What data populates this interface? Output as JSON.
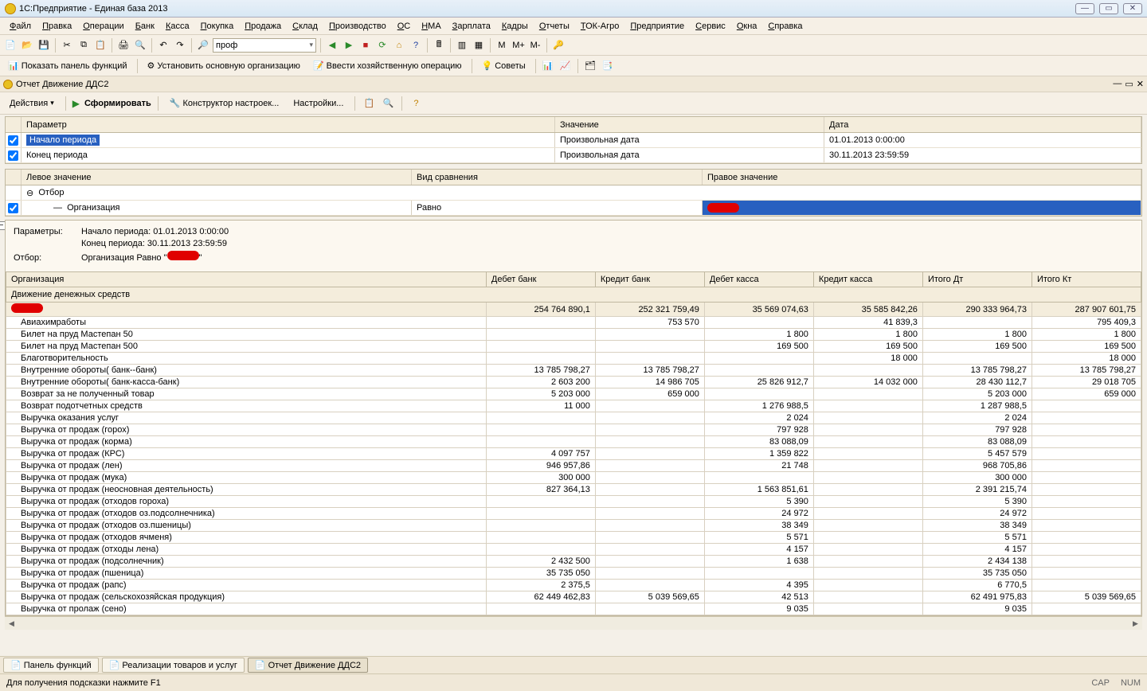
{
  "window": {
    "title": "1С:Предприятие - Единая база 2013"
  },
  "menu": [
    "Файл",
    "Правка",
    "Операции",
    "Банк",
    "Касса",
    "Покупка",
    "Продажа",
    "Склад",
    "Производство",
    "ОС",
    "НМА",
    "Зарплата",
    "Кадры",
    "Отчеты",
    "ТОК-Агро",
    "Предприятие",
    "Сервис",
    "Окна",
    "Справка"
  ],
  "toolbar": {
    "combo_value": "проф",
    "m_buttons": [
      "M",
      "M+",
      "M-"
    ]
  },
  "toolbar2": {
    "show_panel": "Показать панель функций",
    "set_org": "Установить основную организацию",
    "enter_op": "Ввести хозяйственную операцию",
    "advice": "Советы"
  },
  "doc_title": "Отчет  Движение  ДДС2",
  "reportbar": {
    "actions": "Действия",
    "generate": "Сформировать",
    "constructor": "Конструктор настроек...",
    "settings": "Настройки..."
  },
  "params_grid": {
    "headers": [
      "Параметр",
      "Значение",
      "Дата"
    ],
    "rows": [
      {
        "checked": true,
        "selected": true,
        "param": "Начало периода",
        "value": "Произвольная дата",
        "date": "01.01.2013 0:00:00"
      },
      {
        "checked": true,
        "selected": false,
        "param": "Конец периода",
        "value": "Произвольная дата",
        "date": "30.11.2013 23:59:59"
      }
    ]
  },
  "filter_grid": {
    "headers": [
      "Левое значение",
      "Вид сравнения",
      "Правое значение"
    ],
    "root": "Отбор",
    "row": {
      "checked": true,
      "left": "Организация",
      "compare": "Равно",
      "right_redacted": true
    }
  },
  "report_header": {
    "params_label": "Параметры:",
    "start": "Начало периода: 01.01.2013 0:00:00",
    "end": "Конец периода: 30.11.2013 23:59:59",
    "filter_label": "Отбор:",
    "filter_text_prefix": "Организация Равно \"",
    "filter_text_suffix": "\""
  },
  "columns": [
    "Организация",
    "Дебет банк",
    "Кредит банк",
    "Дебет касса",
    "Кредит касса",
    "Итого Дт",
    "Итого Кт"
  ],
  "subheader": "Движение денежных средств",
  "org_row": {
    "redacted": true,
    "values": [
      "254 764 890,1",
      "252 321 759,49",
      "35 569 074,63",
      "35 585 842,26",
      "290 333 964,73",
      "287 907 601,75"
    ]
  },
  "rows": [
    {
      "name": "Авиахимработы",
      "v": [
        "",
        "753 570",
        "",
        "41 839,3",
        "",
        "795 409,3"
      ]
    },
    {
      "name": "Билет на пруд Мастепан 50",
      "v": [
        "",
        "",
        "1 800",
        "1 800",
        "1 800",
        "1 800"
      ]
    },
    {
      "name": "Билет на пруд Мастепан 500",
      "v": [
        "",
        "",
        "169 500",
        "169 500",
        "169 500",
        "169 500"
      ]
    },
    {
      "name": "Благотворительность",
      "v": [
        "",
        "",
        "",
        "18 000",
        "",
        "18 000"
      ]
    },
    {
      "name": "Внутренние обороты( банк--банк)",
      "v": [
        "13 785 798,27",
        "13 785 798,27",
        "",
        "",
        "13 785 798,27",
        "13 785 798,27"
      ]
    },
    {
      "name": "Внутренние обороты( банк-касса-банк)",
      "v": [
        "2 603 200",
        "14 986 705",
        "25 826 912,7",
        "14 032 000",
        "28 430 112,7",
        "29 018 705"
      ]
    },
    {
      "name": "Возврат за не полученный товар",
      "v": [
        "5 203 000",
        "659 000",
        "",
        "",
        "5 203 000",
        "659 000"
      ]
    },
    {
      "name": "Возврат подотчетных средств",
      "v": [
        "11 000",
        "",
        "1 276 988,5",
        "",
        "1 287 988,5",
        ""
      ]
    },
    {
      "name": "Выручка оказания услуг",
      "v": [
        "",
        "",
        "2 024",
        "",
        "2 024",
        ""
      ]
    },
    {
      "name": "Выручка от продаж (горох)",
      "v": [
        "",
        "",
        "797 928",
        "",
        "797 928",
        ""
      ]
    },
    {
      "name": "Выручка от продаж (корма)",
      "v": [
        "",
        "",
        "83 088,09",
        "",
        "83 088,09",
        ""
      ]
    },
    {
      "name": "Выручка от продаж (КРС)",
      "v": [
        "4 097 757",
        "",
        "1 359 822",
        "",
        "5 457 579",
        ""
      ]
    },
    {
      "name": "Выручка от продаж (лен)",
      "v": [
        "946 957,86",
        "",
        "21 748",
        "",
        "968 705,86",
        ""
      ]
    },
    {
      "name": "Выручка от продаж (мука)",
      "v": [
        "300 000",
        "",
        "",
        "",
        "300 000",
        ""
      ]
    },
    {
      "name": "Выручка от продаж (неосновная деятельность)",
      "v": [
        "827 364,13",
        "",
        "1 563 851,61",
        "",
        "2 391 215,74",
        ""
      ]
    },
    {
      "name": "Выручка от продаж (отходов гороха)",
      "v": [
        "",
        "",
        "5 390",
        "",
        "5 390",
        ""
      ]
    },
    {
      "name": "Выручка от продаж (отходов оз.подсолнечника)",
      "v": [
        "",
        "",
        "24 972",
        "",
        "24 972",
        ""
      ]
    },
    {
      "name": "Выручка от продаж (отходов оз.пшеницы)",
      "v": [
        "",
        "",
        "38 349",
        "",
        "38 349",
        ""
      ]
    },
    {
      "name": "Выручка от продаж (отходов ячменя)",
      "v": [
        "",
        "",
        "5 571",
        "",
        "5 571",
        ""
      ]
    },
    {
      "name": "Выручка от продаж (отходы лена)",
      "v": [
        "",
        "",
        "4 157",
        "",
        "4 157",
        ""
      ]
    },
    {
      "name": "Выручка от продаж (подсолнечник)",
      "v": [
        "2 432 500",
        "",
        "1 638",
        "",
        "2 434 138",
        ""
      ]
    },
    {
      "name": "Выручка от продаж (пшеница)",
      "v": [
        "35 735 050",
        "",
        "",
        "",
        "35 735 050",
        ""
      ]
    },
    {
      "name": "Выручка от продаж (рапс)",
      "v": [
        "2 375,5",
        "",
        "4 395",
        "",
        "6 770,5",
        ""
      ]
    },
    {
      "name": "Выручка от продаж (сельскохозяйская продукция)",
      "v": [
        "62 449 462,83",
        "5 039 569,65",
        "42 513",
        "",
        "62 491 975,83",
        "5 039 569,65"
      ]
    },
    {
      "name": "Выручка от пролаж (сено)",
      "v": [
        "",
        "",
        "9 035",
        "",
        "9 035",
        ""
      ]
    }
  ],
  "tasks": [
    {
      "label": "Панель функций",
      "active": false
    },
    {
      "label": "Реализации товаров и услуг",
      "active": false
    },
    {
      "label": "Отчет  Движение  ДДС2",
      "active": true
    }
  ],
  "statusbar": {
    "hint": "Для получения подсказки нажмите F1",
    "cap": "CAP",
    "num": "NUM"
  }
}
